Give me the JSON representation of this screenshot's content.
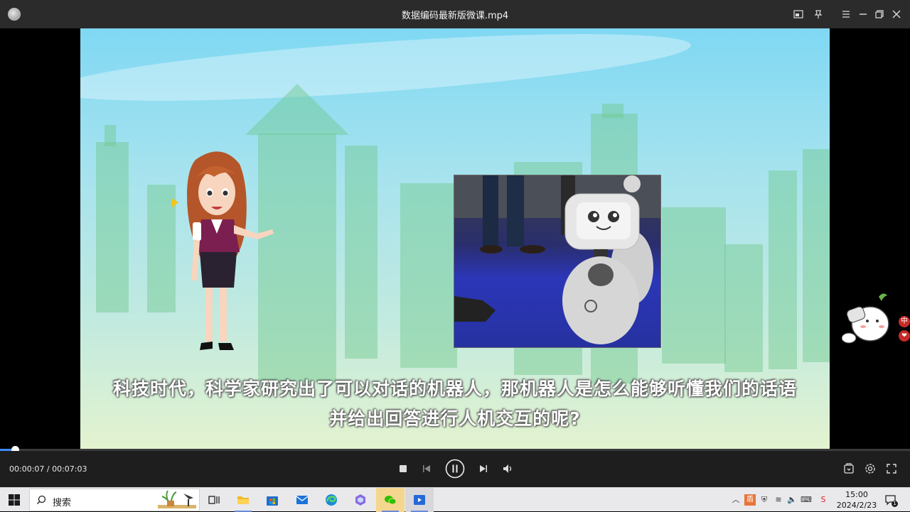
{
  "window": {
    "title": "数据编码最新版微课.mp4"
  },
  "video": {
    "subtitle_line1": "科技时代，科学家研究出了可以对话的机器人，那机器人是怎么能够听懂我们的话语",
    "subtitle_line2": "并给出回答进行人机交互的呢?",
    "progress_fraction": 0.0166
  },
  "controls": {
    "time_display": "00:00:07 / 00:07:03"
  },
  "taskbar": {
    "search_label": "搜索",
    "clock_time": "15:00",
    "clock_date": "2024/2/23",
    "ime_label": "中",
    "notification_count": "1"
  },
  "colors": {
    "accent": "#3f8cff",
    "titlebar": "#2b2b2b",
    "controlbar": "#1e1e1e",
    "taskbar": "#e9e9ec"
  }
}
